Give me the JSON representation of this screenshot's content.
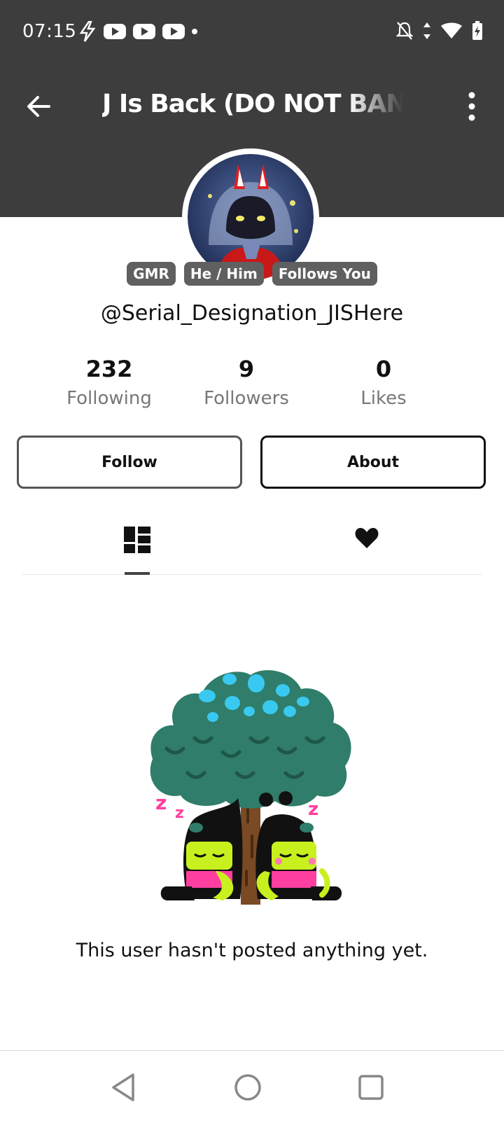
{
  "status_bar": {
    "time": "07:15",
    "left_icons": [
      "flash-icon",
      "youtube-icon",
      "youtube-icon",
      "youtube-icon",
      "dot-icon"
    ],
    "right_icons": [
      "do-not-disturb-off-icon",
      "data-arrows-icon",
      "wifi-icon",
      "battery-charging-icon"
    ]
  },
  "header": {
    "title": "J  Is Back (DO NOT BAN",
    "back_icon": "arrow-left-icon",
    "more_icon": "more-vertical-icon"
  },
  "profile": {
    "badges": [
      "GMR",
      "He / Him",
      "Follows You"
    ],
    "username": "@Serial_Designation_JISHere",
    "stats": [
      {
        "value": "232",
        "label": "Following"
      },
      {
        "value": "9",
        "label": "Followers"
      },
      {
        "value": "0",
        "label": "Likes"
      }
    ],
    "follow_label": "Follow",
    "about_label": "About"
  },
  "tabs": [
    {
      "icon": "posts-grid-icon",
      "active": true
    },
    {
      "icon": "heart-icon",
      "active": false
    }
  ],
  "empty_state": {
    "message": "This user hasn't posted anything yet."
  },
  "nav": {
    "icons": [
      "back-triangle-icon",
      "home-circle-icon",
      "recents-square-icon"
    ]
  },
  "colors": {
    "header_bg": "#3d3d3d",
    "badge_bg": "#606060",
    "tree_canopy": "#2f7d6a",
    "tree_spots": "#39c9f0",
    "character_green": "#c8f01e",
    "zzz_pink": "#ff3fa0"
  }
}
